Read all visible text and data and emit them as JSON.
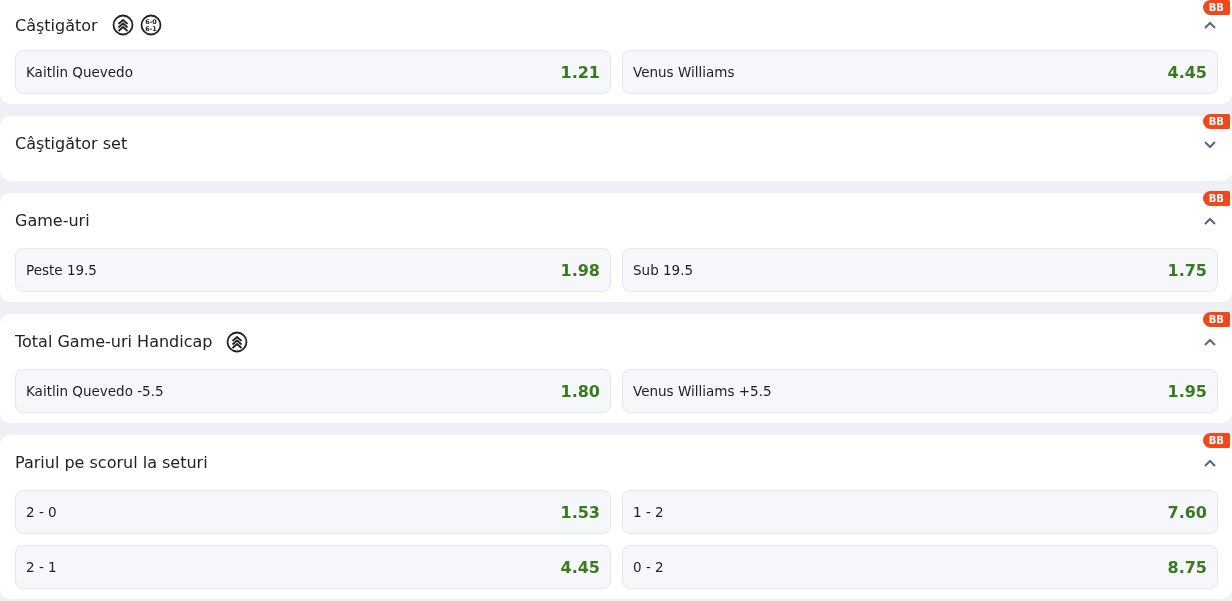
{
  "markets": [
    {
      "title": "Câştigător",
      "badge": "BB",
      "expanded": true,
      "icons": [
        {
          "kind": "boost"
        },
        {
          "kind": "score",
          "lines": [
            "6-0",
            "6-1"
          ]
        }
      ],
      "outcomes": [
        {
          "label": "Kaitlin Quevedo",
          "odds": "1.21"
        },
        {
          "label": "Venus Williams",
          "odds": "4.45"
        }
      ]
    },
    {
      "title": "Câştigător set",
      "badge": "BB",
      "expanded": false
    },
    {
      "title": "Game-uri",
      "badge": "BB",
      "expanded": true,
      "outcomes": [
        {
          "label": "Peste 19.5",
          "odds": "1.98"
        },
        {
          "label": "Sub 19.5",
          "odds": "1.75"
        }
      ]
    },
    {
      "title": "Total Game-uri Handicap",
      "badge": "BB",
      "expanded": true,
      "icons": [
        {
          "kind": "boost"
        }
      ],
      "outcomes": [
        {
          "label": "Kaitlin Quevedo -5.5",
          "odds": "1.80"
        },
        {
          "label": "Venus Williams +5.5",
          "odds": "1.95"
        }
      ]
    },
    {
      "title": "Pariul pe scorul la seturi",
      "badge": "BB",
      "expanded": true,
      "outcomes": [
        {
          "label": "2 - 0",
          "odds": "1.53"
        },
        {
          "label": "1 - 2",
          "odds": "7.60"
        },
        {
          "label": "2 - 1",
          "odds": "4.45"
        },
        {
          "label": "0 - 2",
          "odds": "8.75"
        }
      ]
    }
  ]
}
